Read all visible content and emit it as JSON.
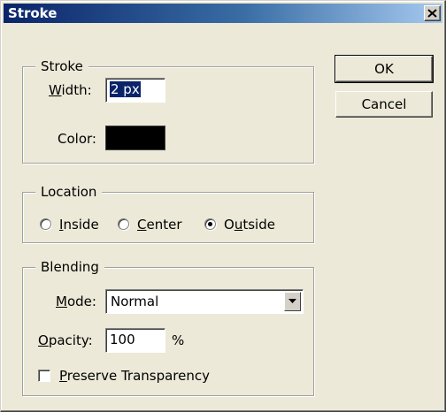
{
  "window": {
    "title": "Stroke"
  },
  "titlebar": {
    "close_icon": "close-icon"
  },
  "stroke_group": {
    "legend": "Stroke",
    "width_label_accel": "W",
    "width_label_rest": "idth:",
    "width_value": "2 px",
    "color_label": "Color:",
    "color_value": "#000000"
  },
  "location_group": {
    "legend": "Location",
    "options": [
      {
        "accel": "I",
        "rest": "nside",
        "selected": false
      },
      {
        "accel": "C",
        "rest": "enter",
        "selected": false
      },
      {
        "pre": "O",
        "accel": "u",
        "rest": "tside",
        "selected": true
      }
    ]
  },
  "blending_group": {
    "legend": "Blending",
    "mode_label_accel": "M",
    "mode_label_rest": "ode:",
    "mode_value": "Normal",
    "dropdown_icon": "chevron-down-icon",
    "opacity_label_accel": "O",
    "opacity_label_rest": "pacity:",
    "opacity_value": "100",
    "opacity_unit": "%",
    "preserve_accel": "P",
    "preserve_rest": "reserve Transparency",
    "preserve_checked": false
  },
  "buttons": {
    "ok": "OK",
    "cancel": "Cancel"
  }
}
